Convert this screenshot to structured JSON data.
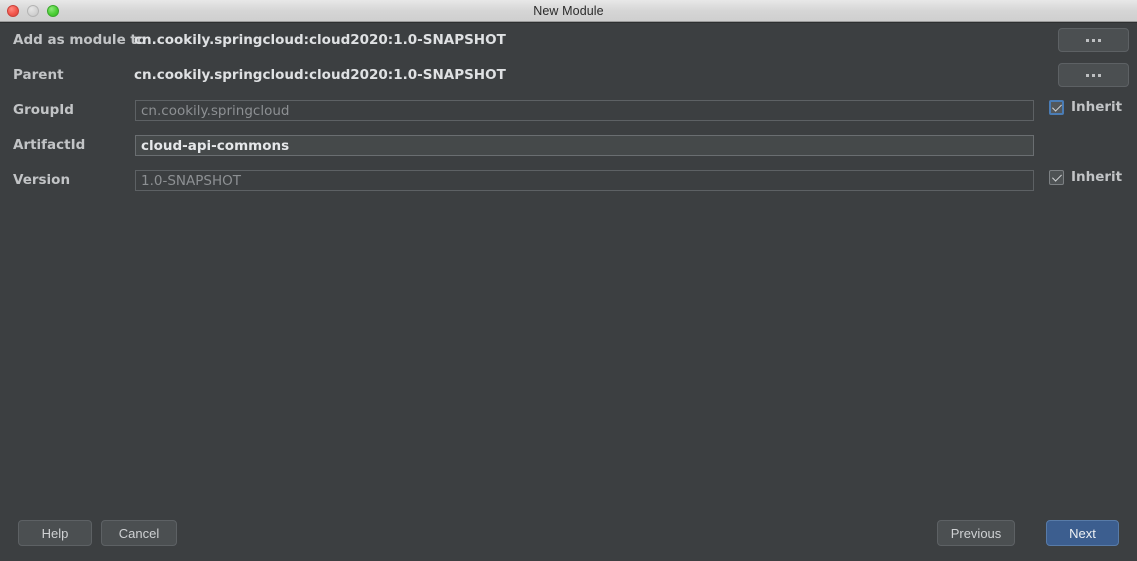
{
  "window": {
    "title": "New Module",
    "traffic_lights": [
      {
        "name": "close-button",
        "color": "#f2564c"
      },
      {
        "name": "minimize-button",
        "color": "#d2d2d2"
      },
      {
        "name": "maximize-button",
        "color": "#4ccf35"
      }
    ]
  },
  "form": {
    "rows": [
      {
        "label": "Add as module to",
        "type": "value",
        "value": "cn.cookily.springcloud:cloud2020:1.0-SNAPSHOT",
        "chooser_label": "..."
      },
      {
        "label": "Parent",
        "type": "value",
        "value": "cn.cookily.springcloud:cloud2020:1.0-SNAPSHOT",
        "chooser_label": "..."
      },
      {
        "label": "GroupId",
        "type": "input",
        "value": "cn.cookily.springcloud",
        "active": false,
        "inherit": {
          "label": "Inherit",
          "checked": true,
          "focused": true
        }
      },
      {
        "label": "ArtifactId",
        "type": "input",
        "value": "cloud-api-commons",
        "active": true,
        "inherit": null
      },
      {
        "label": "Version",
        "type": "input",
        "value": "1.0-SNAPSHOT",
        "active": false,
        "inherit": {
          "label": "Inherit",
          "checked": true,
          "focused": false
        }
      }
    ]
  },
  "footer": {
    "help_label": "Help",
    "cancel_label": "Cancel",
    "previous_label": "Previous",
    "next_label": "Next",
    "next_accent_color": "#3c5e8f"
  }
}
